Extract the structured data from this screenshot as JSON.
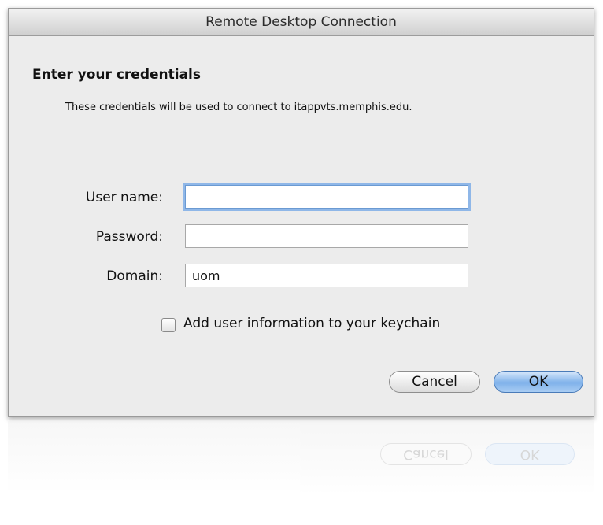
{
  "window": {
    "title": "Remote Desktop Connection"
  },
  "dialog": {
    "heading": "Enter your credentials",
    "description": "These credentials will be used to connect to itappvts.memphis.edu."
  },
  "form": {
    "username": {
      "label": "User name:",
      "value": ""
    },
    "password": {
      "label": "Password:",
      "value": ""
    },
    "domain": {
      "label": "Domain:",
      "value": "uom"
    },
    "keychain": {
      "label": "Add user information to your keychain",
      "checked": false
    }
  },
  "buttons": {
    "cancel": "Cancel",
    "ok": "OK"
  }
}
